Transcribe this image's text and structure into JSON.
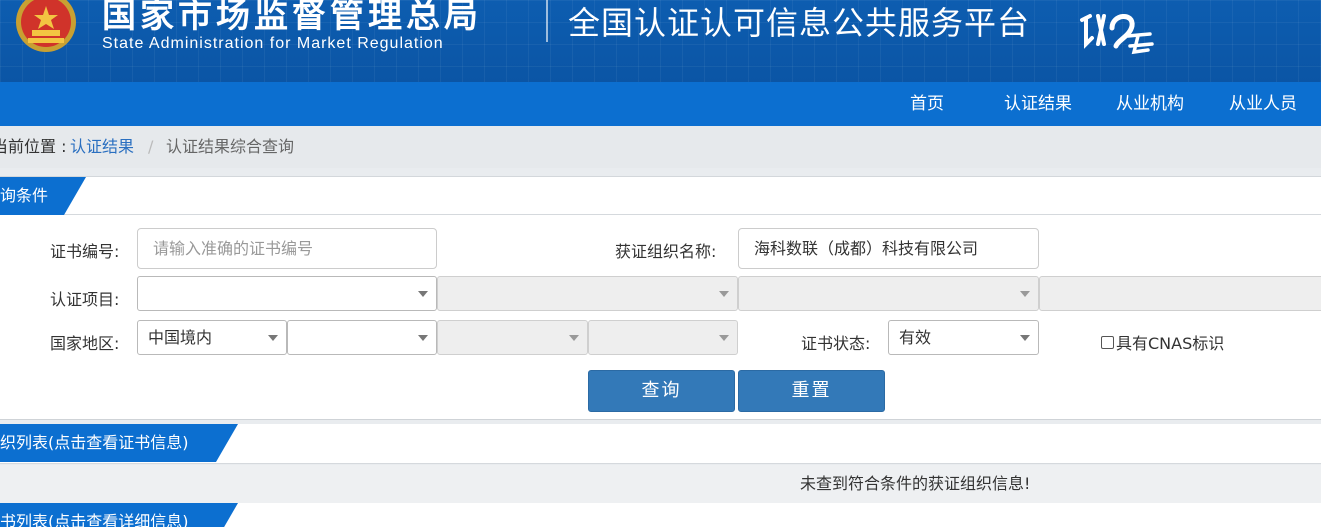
{
  "header": {
    "cn_title": "国家市场监督管理总局",
    "en_title": "State Administration  for  Market Regulation",
    "platform_title": "全国认证认可信息公共服务平台",
    "logo_text": "认云"
  },
  "nav": {
    "items": [
      "首页",
      "认证结果",
      "从业机构",
      "从业人员"
    ]
  },
  "breadcrumb": {
    "label": "当前位置 :",
    "link": "认证结果",
    "separator": "/",
    "current": "认证结果综合查询"
  },
  "query": {
    "section_title": "查询条件",
    "cert_no_label": "证书编号:",
    "cert_no_placeholder": "请输入准确的证书编号",
    "org_name_label": "获证组织名称:",
    "org_name_value": "海科数联（成都）科技有限公司",
    "project_label": "认证项目:",
    "region_label": "国家地区:",
    "region_value": "中国境内",
    "status_label": "证书状态:",
    "status_value": "有效",
    "cnas_label": "具有CNAS标识",
    "search_button": "查询",
    "reset_button": "重置"
  },
  "org_list": {
    "section_title": "组织列表(点击查看证书信息)",
    "empty_message": "未查到符合条件的获证组织信息!"
  },
  "cert_list": {
    "section_title": "证书列表(点击查看详细信息)"
  },
  "colors": {
    "header_blue": "#0d5db0",
    "nav_blue": "#0c6fd0",
    "button_blue": "#3379b8",
    "link_blue": "#2a6fc0"
  }
}
